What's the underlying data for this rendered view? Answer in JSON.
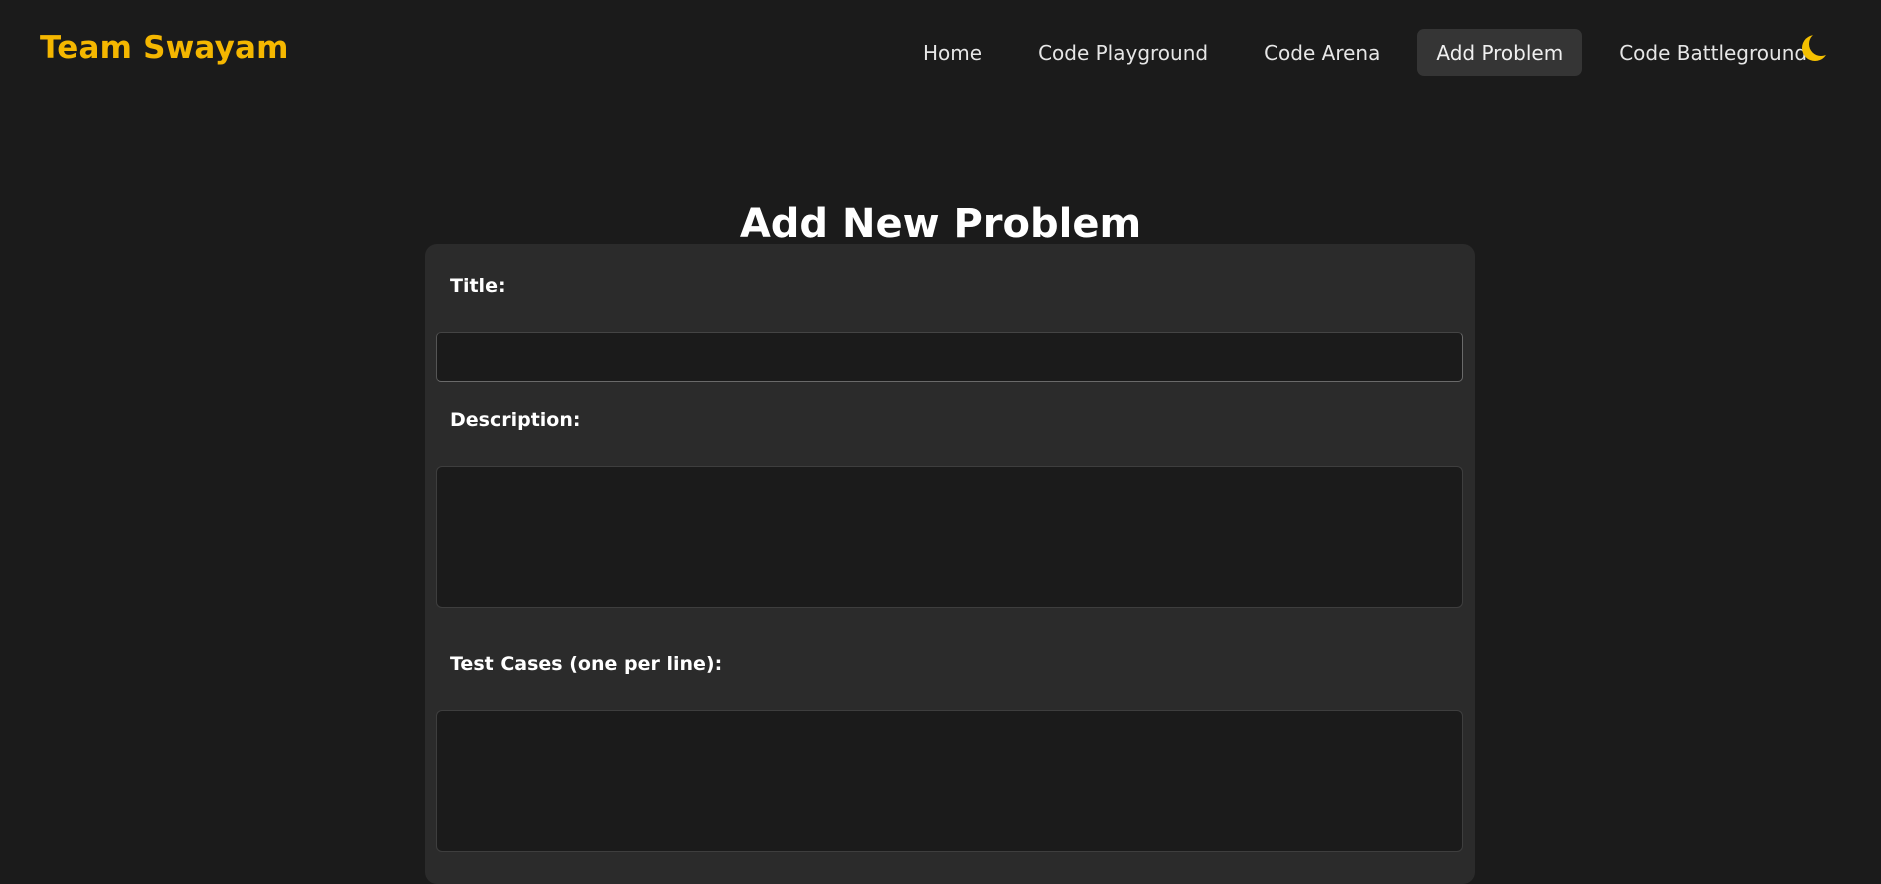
{
  "brand": {
    "name": "Team Swayam",
    "color": "#f5b700"
  },
  "nav": {
    "links": [
      {
        "label": "Home",
        "active": false
      },
      {
        "label": "Code Playground",
        "active": false
      },
      {
        "label": "Code Arena",
        "active": false
      },
      {
        "label": "Add Problem",
        "active": true
      },
      {
        "label": "Code Battleground",
        "active": false
      }
    ],
    "theme_toggle_icon": "crescent-moon-icon",
    "theme_toggle_color": "#f5c000"
  },
  "page": {
    "title": "Add New Problem"
  },
  "form": {
    "title_label": "Title:",
    "title_value": "",
    "description_label": "Description:",
    "description_value": "",
    "test_cases_label": "Test Cases (one per line):",
    "test_cases_value": ""
  },
  "colors": {
    "background": "#1b1b1b",
    "card": "#2b2b2b",
    "active_nav": "#353535"
  }
}
